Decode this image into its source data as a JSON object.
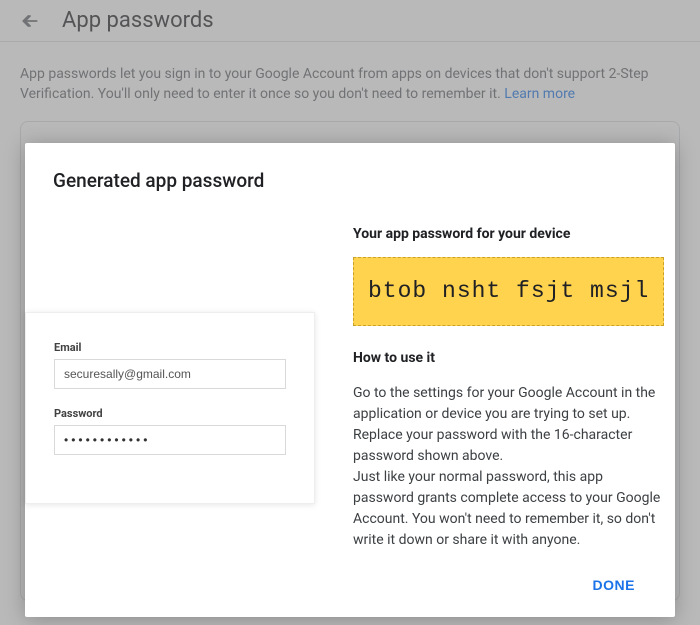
{
  "header": {
    "title": "App passwords"
  },
  "intro": {
    "text": "App passwords let you sign in to your Google Account from apps on devices that don't support 2-Step Verification. You'll only need to enter it once so you don't need to remember it. ",
    "link_text": "Learn more"
  },
  "dialog": {
    "title": "Generated app password",
    "device_heading": "Your app password for your device",
    "password": "btob nsht fsjt msjl",
    "howto_heading": "How to use it",
    "howto_text1": "Go to the settings for your Google Account in the application or device you are trying to set up. Replace your password with the 16-character password shown above.",
    "howto_text2": "Just like your normal password, this app password grants complete access to your Google Account. You won't need to remember it, so don't write it down or share it with anyone.",
    "done_label": "DONE"
  },
  "login_card": {
    "email_label": "Email",
    "email_value": "securesally@gmail.com",
    "password_label": "Password",
    "password_value": "••••••••••••"
  }
}
